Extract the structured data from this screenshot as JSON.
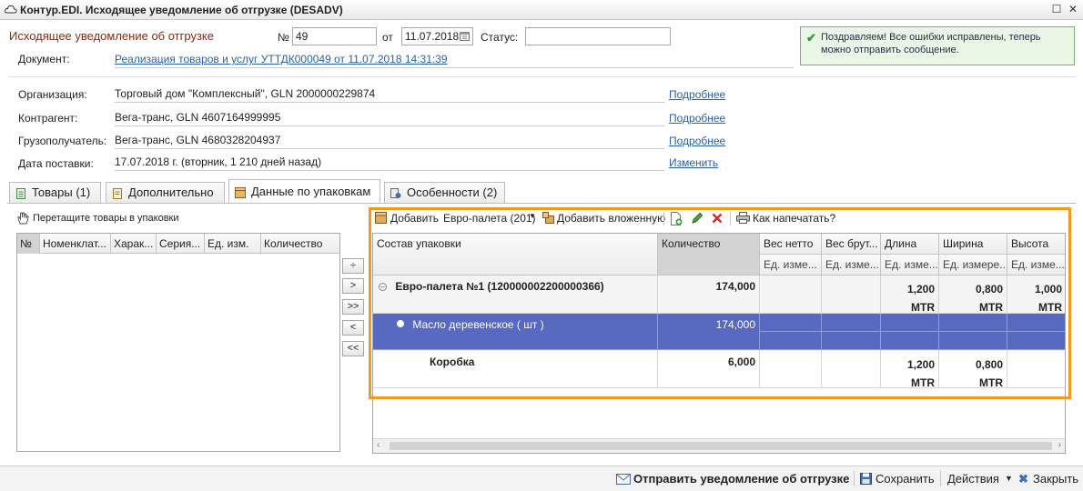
{
  "window": {
    "title": "Контур.EDI. Исходящее уведомление об отгрузке (DESADV)",
    "restore_glyph": "☐",
    "close_glyph": "✕"
  },
  "header": {
    "doc_title": "Исходящее уведомление об отгрузке",
    "number_label": "№",
    "number_value": "49",
    "date_label": "от",
    "date_value": "11.07.2018",
    "status_label": "Статус:",
    "status_value": "",
    "document_label": "Документ:",
    "document_link": "Реализация товаров и услуг УТТДК000049 от 11.07.2018 14:31:39",
    "notice": "Поздравляем! Все ошибки исправлены, теперь можно отправить сообщение."
  },
  "details": [
    {
      "label": "Организация:",
      "value": "Торговый дом \"Комплексный\", GLN 2000000229874",
      "link": "Подробнее"
    },
    {
      "label": "Контрагент:",
      "value": "Вега-транс, GLN 4607164999995",
      "link": "Подробнее"
    },
    {
      "label": "Грузополучатель:",
      "value": "Вега-транс, GLN 4680328204937",
      "link": "Подробнее"
    },
    {
      "label": "Дата поставки:",
      "value": "17.07.2018 г. (вторник, 1 210 дней назад)",
      "link": "Изменить"
    }
  ],
  "tabs": [
    {
      "label": "Товары (1)"
    },
    {
      "label": "Дополнительно"
    },
    {
      "label": "Данные по упаковкам"
    },
    {
      "label": "Особенности (2)"
    }
  ],
  "left_panel": {
    "drag_hint": "Перетащите товары в упаковки",
    "columns": [
      "№",
      "Номенклат...",
      "Харак...",
      "Серия...",
      "Ед. изм.",
      "Количество"
    ]
  },
  "move_buttons": [
    "÷",
    ">",
    ">>",
    "<",
    "<<"
  ],
  "toolbar": {
    "add": "Добавить",
    "pallet_type": "Евро-палета (201)",
    "add_nested": "Добавить вложенную",
    "how_print": "Как напечатать?"
  },
  "grid": {
    "columns": [
      {
        "title": "Состав упаковки",
        "sub": ""
      },
      {
        "title": "Количество",
        "sub": ""
      },
      {
        "title": "Вес нетто",
        "sub": "Ед. изме..."
      },
      {
        "title": "Вес брут...",
        "sub": "Ед. изме..."
      },
      {
        "title": "Длина",
        "sub": "Ед. изме..."
      },
      {
        "title": "Ширина",
        "sub": "Ед. измере..."
      },
      {
        "title": "Высота",
        "sub": "Ед. изме..."
      }
    ],
    "rows": [
      {
        "name": "Евро-палета №1 (120000002200000366)",
        "qty": "174,000",
        "len": "1,200",
        "len_unit": "MTR",
        "wid": "0,800",
        "wid_unit": "MTR",
        "hgt": "1,000",
        "hgt_unit": "MTR"
      },
      {
        "name": "Масло деревенское ( шт )",
        "qty": "174,000"
      },
      {
        "name": "Коробка",
        "qty": "6,000",
        "len": "1,200",
        "len_unit": "MTR",
        "wid": "0,800",
        "wid_unit": "MTR"
      }
    ]
  },
  "bottom": {
    "send": "Отправить уведомление об отгрузке",
    "save": "Сохранить",
    "actions": "Действия",
    "close": "Закрыть"
  },
  "colors": {
    "selection": "#5769c0",
    "highlight_frame": "#f29a1d",
    "doc_title": "#8b2a12",
    "link": "#2a62a8"
  }
}
